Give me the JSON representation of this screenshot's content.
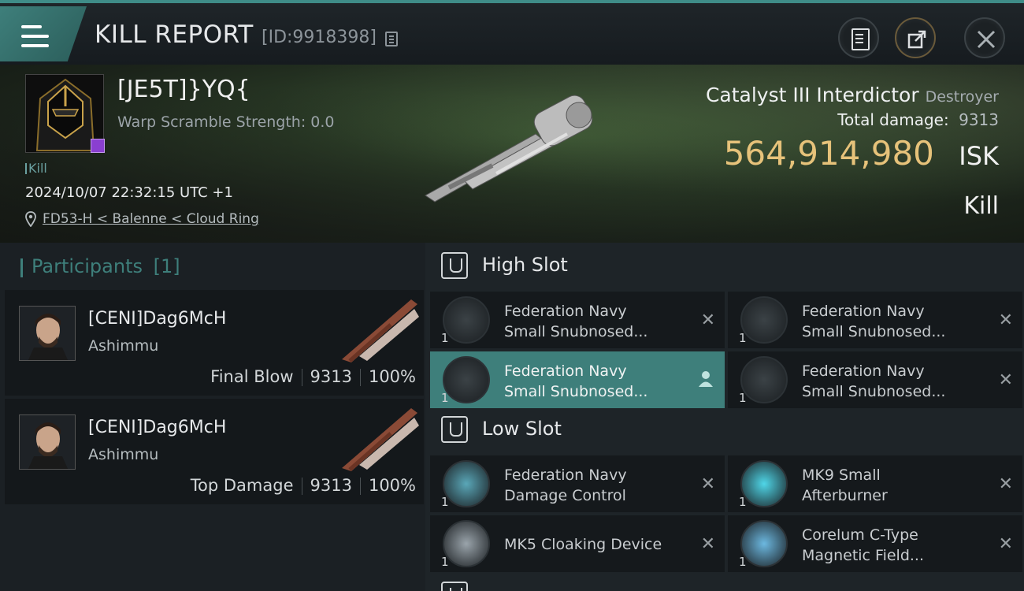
{
  "header": {
    "title": "KILL REPORT",
    "id_text": "[ID:9918398]"
  },
  "victim": {
    "name": "[JE5T]}YQ{",
    "warp_scramble": "Warp Scramble Strength: 0.0",
    "tag": "Kill",
    "datetime": "2024/10/07 22:32:15 UTC +1",
    "location": "FD53-H < Balenne < Cloud Ring",
    "ship_name": "Catalyst III Interdictor",
    "ship_class": "Destroyer",
    "total_damage_label": "Total damage:",
    "total_damage": "9313",
    "isk_value": "564,914,980",
    "isk_unit": "ISK",
    "result": "Kill"
  },
  "participants": {
    "label": "Participants",
    "count": "[1]",
    "list": [
      {
        "name": "[CENI]Dag6McH",
        "ship": "Ashimmu",
        "role": "Final Blow",
        "damage": "9313",
        "percent": "100%"
      },
      {
        "name": "[CENI]Dag6McH",
        "ship": "Ashimmu",
        "role": "Top Damage",
        "damage": "9313",
        "percent": "100%"
      }
    ]
  },
  "fitting": {
    "high_slot_label": "High Slot",
    "low_slot_label": "Low Slot",
    "high_slot": [
      {
        "line1": "Federation Navy",
        "line2": "Small Snubnosed...",
        "qty": "1"
      },
      {
        "line1": "Federation Navy",
        "line2": "Small Snubnosed...",
        "qty": "1"
      },
      {
        "line1": "Federation Navy",
        "line2": "Small Snubnosed...",
        "qty": "1"
      },
      {
        "line1": "Federation Navy",
        "line2": "Small Snubnosed...",
        "qty": "1"
      }
    ],
    "low_slot": [
      {
        "line1": "Federation Navy",
        "line2": "Damage Control",
        "qty": "1"
      },
      {
        "line1": "MK9 Small",
        "line2": "Afterburner",
        "qty": "1"
      },
      {
        "line1": "MK5 Cloaking Device",
        "line2": "",
        "qty": "1"
      },
      {
        "line1": "Corelum C-Type",
        "line2": "Magnetic Field...",
        "qty": "1"
      }
    ]
  },
  "colors": {
    "accent": "#3e7f7b",
    "isk": "#e6c27a"
  }
}
